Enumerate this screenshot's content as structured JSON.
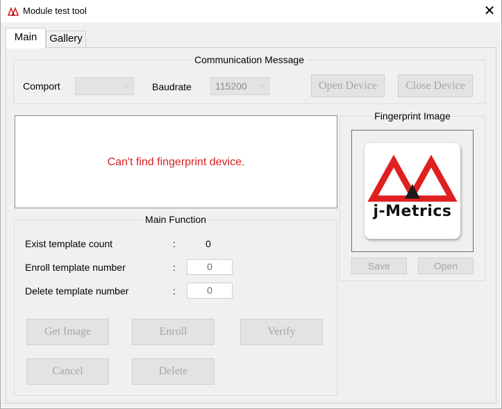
{
  "window": {
    "title": "Module test tool",
    "close_glyph": "✕"
  },
  "tabs": [
    {
      "label": "Main"
    },
    {
      "label": "Gallery"
    }
  ],
  "communication": {
    "title": "Communication Message",
    "comport_label": "Comport",
    "comport_value": "",
    "baudrate_label": "Baudrate",
    "baudrate_value": "115200",
    "open_device": "Open Device",
    "close_device": "Close Device"
  },
  "message": {
    "text": "Can't find fingerprint device.",
    "color": "#d91f1f"
  },
  "main_function": {
    "title": "Main Function",
    "rows": [
      {
        "label": "Exist template count",
        "sep": ":",
        "value": "0"
      },
      {
        "label": "Enroll template number",
        "sep": ":",
        "value": "0"
      },
      {
        "label": "Delete template number",
        "sep": ":",
        "value": "0"
      }
    ],
    "buttons": {
      "get_image": "Get Image",
      "enroll": "Enroll",
      "verify": "Verify",
      "cancel": "Cancel",
      "delete": "Delete"
    }
  },
  "fingerprint": {
    "title": "Fingerprint Image",
    "logo_text": "j-Metrics",
    "save": "Save",
    "open": "Open"
  },
  "colors": {
    "accent_red": "#d91f1f",
    "logo_red": "#e02020",
    "disabled_text": "#a6a6a6"
  }
}
